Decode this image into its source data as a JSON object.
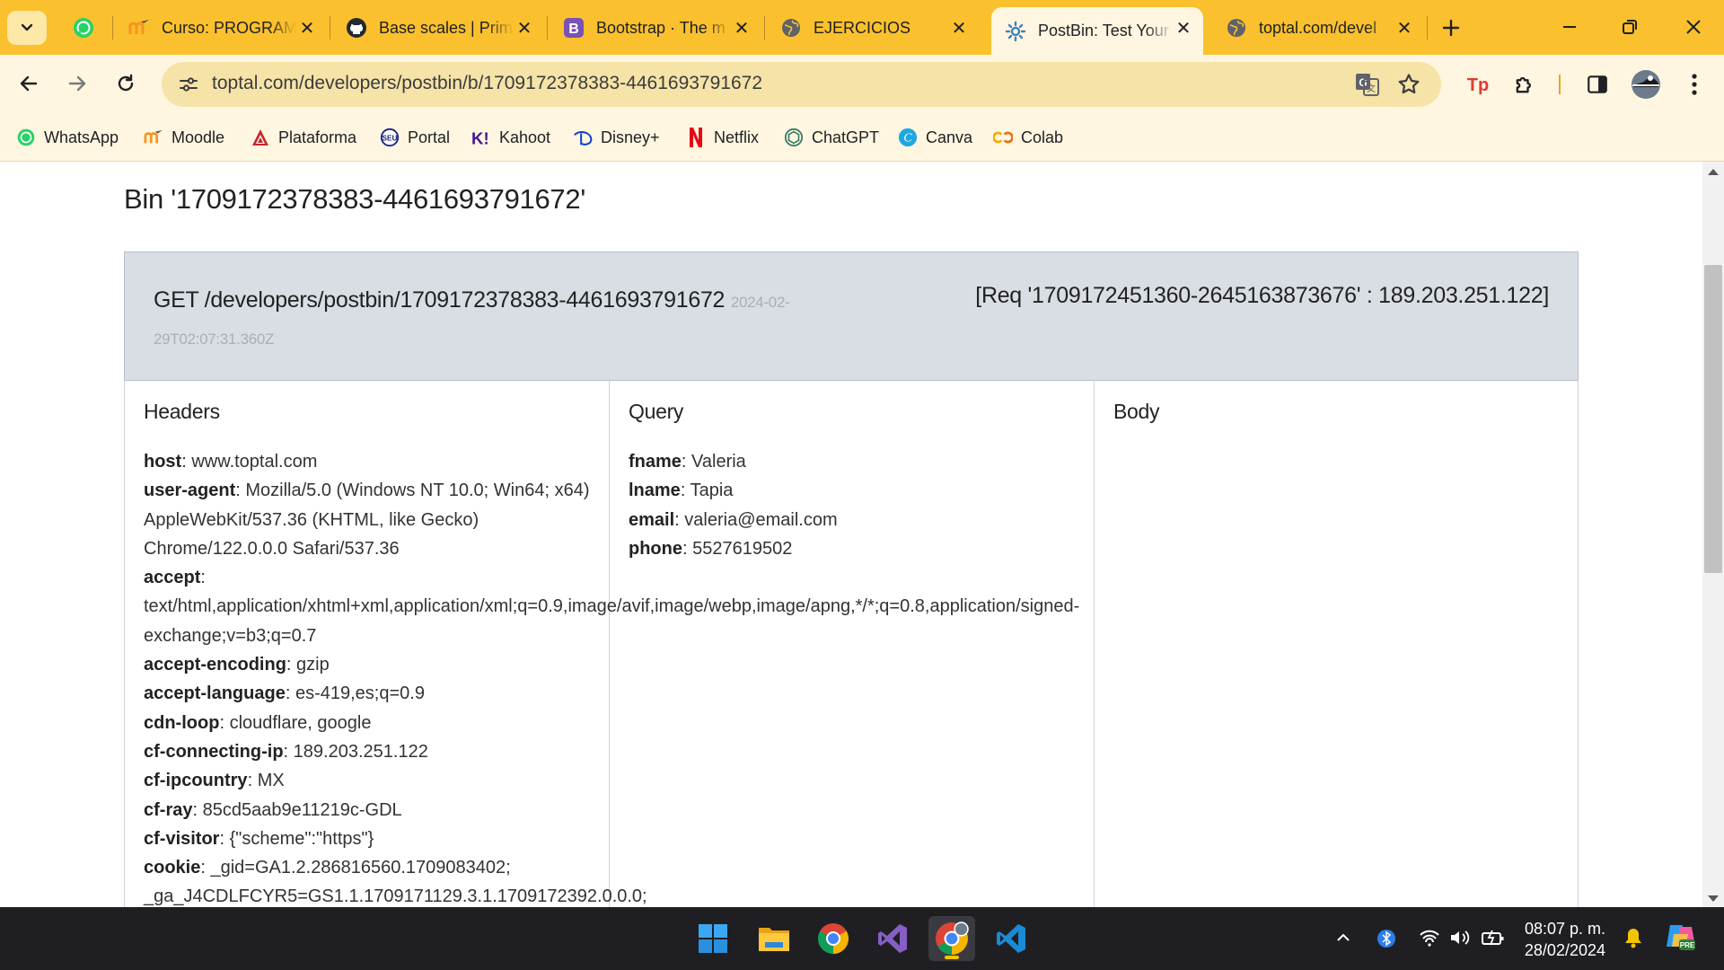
{
  "browser": {
    "tabs": [
      {
        "title": "Curso: PROGRAM",
        "icon": "moodle-icon"
      },
      {
        "title": "Base scales | Prim",
        "icon": "github-icon"
      },
      {
        "title": "Bootstrap · The m",
        "icon": "bootstrap-icon"
      },
      {
        "title": "EJERCICIOS",
        "icon": "globe-icon"
      },
      {
        "title": "PostBin: Test Your",
        "icon": "postbin-icon",
        "active": true
      },
      {
        "title": "toptal.com/devel",
        "icon": "globe-icon"
      }
    ],
    "url": "toptal.com/developers/postbin/b/1709172378383-4461693791672",
    "bookmarks": [
      {
        "label": "WhatsApp",
        "icon": "whatsapp-icon"
      },
      {
        "label": "Moodle",
        "icon": "moodle-icon"
      },
      {
        "label": "Plataforma",
        "icon": "plataforma-icon"
      },
      {
        "label": "Portal",
        "icon": "portal-icon"
      },
      {
        "label": "Kahoot",
        "icon": "kahoot-icon"
      },
      {
        "label": "Disney+",
        "icon": "disney-icon"
      },
      {
        "label": "Netflix",
        "icon": "netflix-icon"
      },
      {
        "label": "ChatGPT",
        "icon": "chatgpt-icon"
      },
      {
        "label": "Canva",
        "icon": "canva-icon"
      },
      {
        "label": "Colab",
        "icon": "colab-icon"
      }
    ]
  },
  "page": {
    "bin_title": "Bin '1709172378383-4461693791672'",
    "request": {
      "line": "GET /developers/postbin/1709172378383-4461693791672",
      "timestamp": "2024-02-29T02:07:31.360Z",
      "meta": "[Req '1709172451360-2645163873676' : 189.203.251.122]"
    },
    "columns": {
      "headers_title": "Headers",
      "query_title": "Query",
      "body_title": "Body"
    },
    "headers": [
      {
        "key": "host",
        "value": "www.toptal.com"
      },
      {
        "key": "user-agent",
        "value": "Mozilla/5.0 (Windows NT 10.0; Win64; x64) AppleWebKit/537.36 (KHTML, like Gecko) Chrome/122.0.0.0 Safari/537.36"
      },
      {
        "key": "accept",
        "value": "text/html,application/xhtml+xml,application/xml;q=0.9,image/avif,image/webp,image/apng,*/*;q=0.8,application/signed-exchange;v=b3;q=0.7"
      },
      {
        "key": "accept-encoding",
        "value": "gzip"
      },
      {
        "key": "accept-language",
        "value": "es-419,es;q=0.9"
      },
      {
        "key": "cdn-loop",
        "value": "cloudflare, google"
      },
      {
        "key": "cf-connecting-ip",
        "value": "189.203.251.122"
      },
      {
        "key": "cf-ipcountry",
        "value": "MX"
      },
      {
        "key": "cf-ray",
        "value": "85cd5aab9e11219c-GDL"
      },
      {
        "key": "cf-visitor",
        "value": "{\"scheme\":\"https\"}"
      },
      {
        "key": "cookie",
        "value": "_gid=GA1.2.286816560.1709083402; _ga_J4CDLFCYR5=GS1.1.1709171129.3.1.1709172392.0.0.0;"
      }
    ],
    "query": [
      {
        "key": "fname",
        "value": "Valeria"
      },
      {
        "key": "lname",
        "value": "Tapia"
      },
      {
        "key": "email",
        "value": "valeria@email.com"
      },
      {
        "key": "phone",
        "value": "5527619502"
      }
    ]
  },
  "taskbar": {
    "apps": [
      "windows-start-icon",
      "file-explorer-icon",
      "chrome-icon",
      "visual-studio-icon",
      "chrome-profile-icon",
      "vscode-icon"
    ],
    "time": "08:07 p. m.",
    "date": "28/02/2024"
  },
  "colors": {
    "tabstrip": "#FBC02D",
    "toolbar": "#FEF6E0",
    "request_panel": "#D9DEE5",
    "taskbar": "#1F1F23"
  }
}
